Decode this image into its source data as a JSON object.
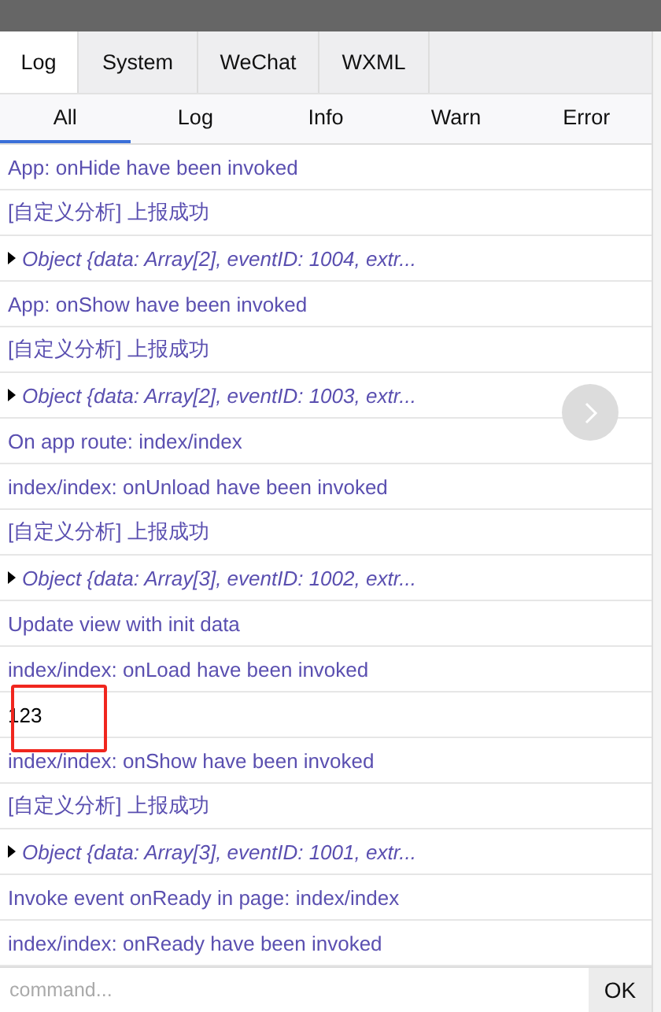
{
  "tabs": [
    {
      "label": "Log",
      "selected": true
    },
    {
      "label": "System",
      "selected": false
    },
    {
      "label": "WeChat",
      "selected": false
    },
    {
      "label": "WXML",
      "selected": false
    }
  ],
  "filters": [
    {
      "label": "All",
      "selected": true
    },
    {
      "label": "Log",
      "selected": false
    },
    {
      "label": "Info",
      "selected": false
    },
    {
      "label": "Warn",
      "selected": false
    },
    {
      "label": "Error",
      "selected": false
    }
  ],
  "log_rows": [
    {
      "kind": "log",
      "text": "App: onHide have been invoked"
    },
    {
      "kind": "log",
      "text": "[自定义分析] 上报成功"
    },
    {
      "kind": "object",
      "text": "Object {data: Array[2], eventID: 1004, extr..."
    },
    {
      "kind": "log",
      "text": "App: onShow have been invoked"
    },
    {
      "kind": "log",
      "text": "[自定义分析] 上报成功"
    },
    {
      "kind": "object",
      "text": "Object {data: Array[2], eventID: 1003, extr..."
    },
    {
      "kind": "log",
      "text": "On app route: index/index"
    },
    {
      "kind": "log",
      "text": "index/index: onUnload have been invoked"
    },
    {
      "kind": "log",
      "text": "[自定义分析] 上报成功"
    },
    {
      "kind": "object",
      "text": "Object {data: Array[3], eventID: 1002, extr..."
    },
    {
      "kind": "log",
      "text": "Update view with init data"
    },
    {
      "kind": "log",
      "text": "index/index: onLoad have been invoked"
    },
    {
      "kind": "plain",
      "text": "123",
      "highlighted": true
    },
    {
      "kind": "log",
      "text": "index/index: onShow have been invoked"
    },
    {
      "kind": "log",
      "text": "[自定义分析] 上报成功"
    },
    {
      "kind": "object",
      "text": "Object {data: Array[3], eventID: 1001, extr..."
    },
    {
      "kind": "log",
      "text": "Invoke event onReady in page: index/index"
    },
    {
      "kind": "log",
      "text": "index/index: onReady have been invoked"
    }
  ],
  "command": {
    "placeholder": "command...",
    "button": "OK"
  }
}
